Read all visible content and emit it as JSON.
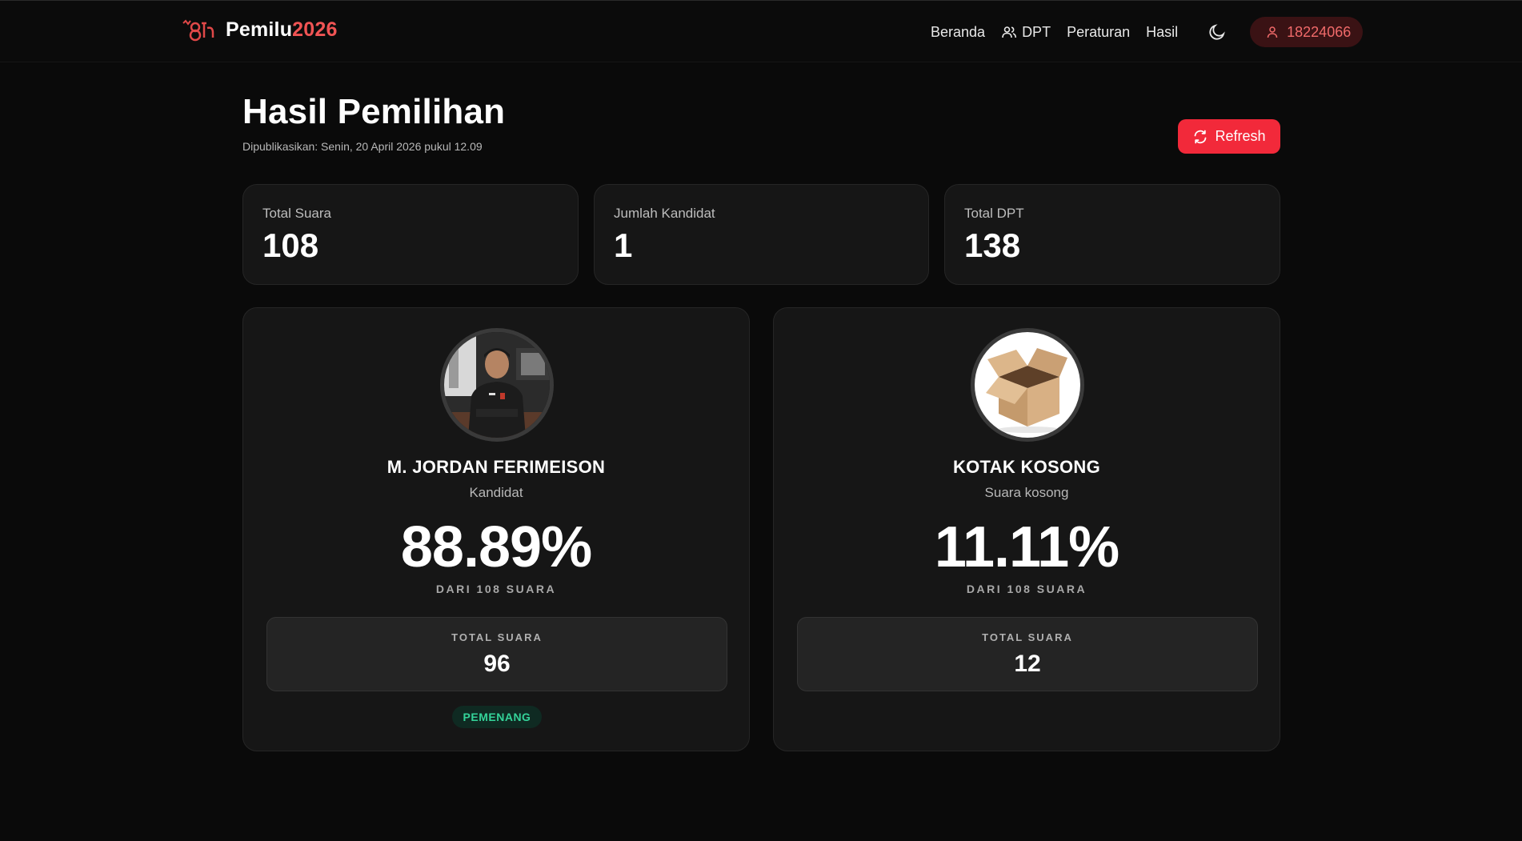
{
  "navbar": {
    "brand": {
      "name": "Pemilu",
      "year": "2026"
    },
    "links": [
      {
        "label": "Beranda",
        "icon": ""
      },
      {
        "label": "DPT",
        "icon": "users-icon"
      },
      {
        "label": "Peraturan",
        "icon": ""
      },
      {
        "label": "Hasil",
        "icon": ""
      }
    ],
    "theme_icon": "moon-icon",
    "user": {
      "icon": "user-icon",
      "id": "18224066"
    }
  },
  "header": {
    "title": "Hasil Pemilihan",
    "published": "Dipublikasikan: Senin, 20 April 2026 pukul 12.09",
    "refresh_label": "Refresh",
    "refresh_icon": "refresh-icon"
  },
  "stats": [
    {
      "label": "Total Suara",
      "value": "108"
    },
    {
      "label": "Jumlah Kandidat",
      "value": "1"
    },
    {
      "label": "Total DPT",
      "value": "138"
    }
  ],
  "candidates": [
    {
      "name": "M. JORDAN FERIMEISON",
      "role": "Kandidat",
      "percent": "88.89%",
      "of_label": "DARI 108 SUARA",
      "total_label": "TOTAL SUARA",
      "total_votes": "96",
      "badge": "PEMENANG",
      "photo": "candidate-photo"
    },
    {
      "name": "KOTAK KOSONG",
      "role": "Suara kosong",
      "percent": "11.11%",
      "of_label": "DARI 108 SUARA",
      "total_label": "TOTAL SUARA",
      "total_votes": "12",
      "photo": "cardboard-box-image"
    }
  ],
  "colors": {
    "background": "#0a0a0a",
    "card": "#161616",
    "accent": "#f2293a",
    "brand_red": "#f05454",
    "winner_green": "#34d399"
  }
}
